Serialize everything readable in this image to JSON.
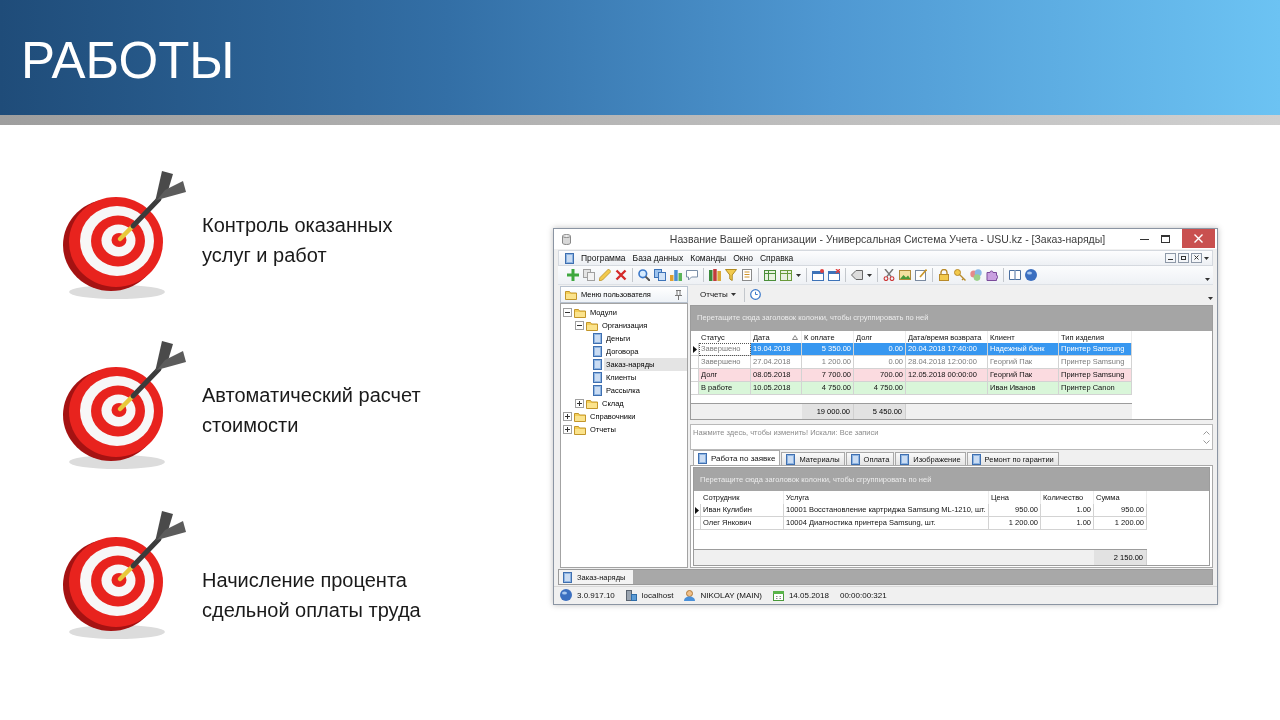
{
  "slide": {
    "title": "РАБОТЫ"
  },
  "features": [
    {
      "lines": [
        "Контроль оказанных",
        "услуг и работ"
      ]
    },
    {
      "lines": [
        "Автоматический расчет",
        "стоимости"
      ]
    },
    {
      "lines": [
        "Начисление процента",
        "сдельной оплаты труда"
      ]
    }
  ],
  "app_window": {
    "title": "Название Вашей организации - Универсальная Система Учета - USU.kz - [Заказ-наряды]",
    "menu": [
      "Программа",
      "База данных",
      "Команды",
      "Окно",
      "Справка"
    ],
    "nav_panel": {
      "title": "Меню пользователя",
      "tree": [
        {
          "label": "Модули",
          "kind": "folder",
          "expanded": true,
          "selected": false,
          "children": [
            {
              "label": "Организация",
              "kind": "folder",
              "expanded": true,
              "selected": false,
              "children": [
                {
                  "label": "Деньги",
                  "kind": "item",
                  "selected": false
                },
                {
                  "label": "Договора",
                  "kind": "item",
                  "selected": false
                },
                {
                  "label": "Заказ-наряды",
                  "kind": "item",
                  "selected": true
                },
                {
                  "label": "Клиенты",
                  "kind": "item",
                  "selected": false
                },
                {
                  "label": "Рассылка",
                  "kind": "item",
                  "selected": false
                }
              ]
            },
            {
              "label": "Склад",
              "kind": "folder",
              "expanded": false,
              "selected": false
            }
          ]
        },
        {
          "label": "Справочники",
          "kind": "folder",
          "expanded": false,
          "selected": false
        },
        {
          "label": "Отчеты",
          "kind": "folder",
          "expanded": false,
          "selected": false
        }
      ]
    },
    "reports_menu": {
      "label": "Отчеты"
    },
    "orders_grid": {
      "focused": true,
      "group_hint": "Перетащите сюда заголовок колонки, чтобы сгруппировать по ней",
      "columns": [
        {
          "label": "Статус",
          "kind": "text",
          "sorted": false
        },
        {
          "label": "Дата",
          "kind": "text",
          "sorted": true
        },
        {
          "label": "К оплате",
          "kind": "number",
          "sorted": false,
          "total": "19 000.00"
        },
        {
          "label": "Долг",
          "kind": "number",
          "sorted": false,
          "total": "5 450.00"
        },
        {
          "label": "Дата/время возврата",
          "kind": "text",
          "sorted": false
        },
        {
          "label": "Клиент",
          "kind": "text",
          "sorted": false
        },
        {
          "label": "Тип изделия",
          "kind": "text",
          "sorted": false
        }
      ],
      "rows": [
        {
          "kind": "done",
          "selected": true,
          "cells": [
            "Завершено",
            "19.04.2018",
            "5 350.00",
            "0.00",
            "20.04.2018 17:40:00",
            "Надежный банк",
            "Принтер Samsung"
          ]
        },
        {
          "kind": "done",
          "selected": false,
          "cells": [
            "Завершено",
            "27.04.2018",
            "1 200.00",
            "0.00",
            "28.04.2018 12:00:00",
            "Георгий Пак",
            "Принтер Samsung"
          ]
        },
        {
          "kind": "debt",
          "selected": false,
          "cells": [
            "Долг",
            "08.05.2018",
            "7 700.00",
            "700.00",
            "12.05.2018 00:00:00",
            "Георгий Пак",
            "Принтер Samsung"
          ]
        },
        {
          "kind": "in_work",
          "selected": false,
          "cells": [
            "В работе",
            "10.05.2018",
            "4 750.00",
            "4 750.00",
            null,
            "Иван Иванов",
            "Принтер Canon"
          ]
        }
      ]
    },
    "filter_panel": {
      "text": "Нажмите здесь, чтобы изменить! Искали: Все записи"
    },
    "detail_tabs": [
      {
        "label": "Работа по заявке",
        "selected": true
      },
      {
        "label": "Материалы",
        "selected": false
      },
      {
        "label": "Оплата",
        "selected": false
      },
      {
        "label": "Изображение",
        "selected": false
      },
      {
        "label": "Ремонт по гарантии",
        "selected": false
      }
    ],
    "detail_grid": {
      "focused": false,
      "group_hint": "Перетащите сюда заголовок колонки, чтобы сгруппировать по ней",
      "columns": [
        {
          "label": "Сотрудник",
          "kind": "text"
        },
        {
          "label": "Услуга",
          "kind": "text"
        },
        {
          "label": "Цена",
          "kind": "number"
        },
        {
          "label": "Количество",
          "kind": "number"
        },
        {
          "label": "Сумма",
          "kind": "number",
          "total": "2 150.00"
        }
      ],
      "rows": [
        {
          "selected": true,
          "cells": [
            "Иван Кулибин",
            "10001 Восстановление картриджа Samsung ML-1210, шт.",
            "950.00",
            "1.00",
            "950.00"
          ]
        },
        {
          "selected": false,
          "cells": [
            "Олег Янкович",
            "10004 Диагностика принтера Samsung, шт.",
            "1 200.00",
            "1.00",
            "1 200.00"
          ]
        }
      ]
    },
    "document_tabs": [
      {
        "label": "Заказ-наряды",
        "selected": true
      }
    ],
    "status_bar": [
      {
        "kind": "version",
        "text": "3.0.917.10"
      },
      {
        "kind": "server",
        "text": "localhost"
      },
      {
        "kind": "user",
        "text": "NIKOLAY (MAIN)"
      },
      {
        "kind": "date",
        "text": "14.05.2018"
      },
      {
        "kind": "time",
        "text": "00:00:00:321"
      }
    ]
  }
}
